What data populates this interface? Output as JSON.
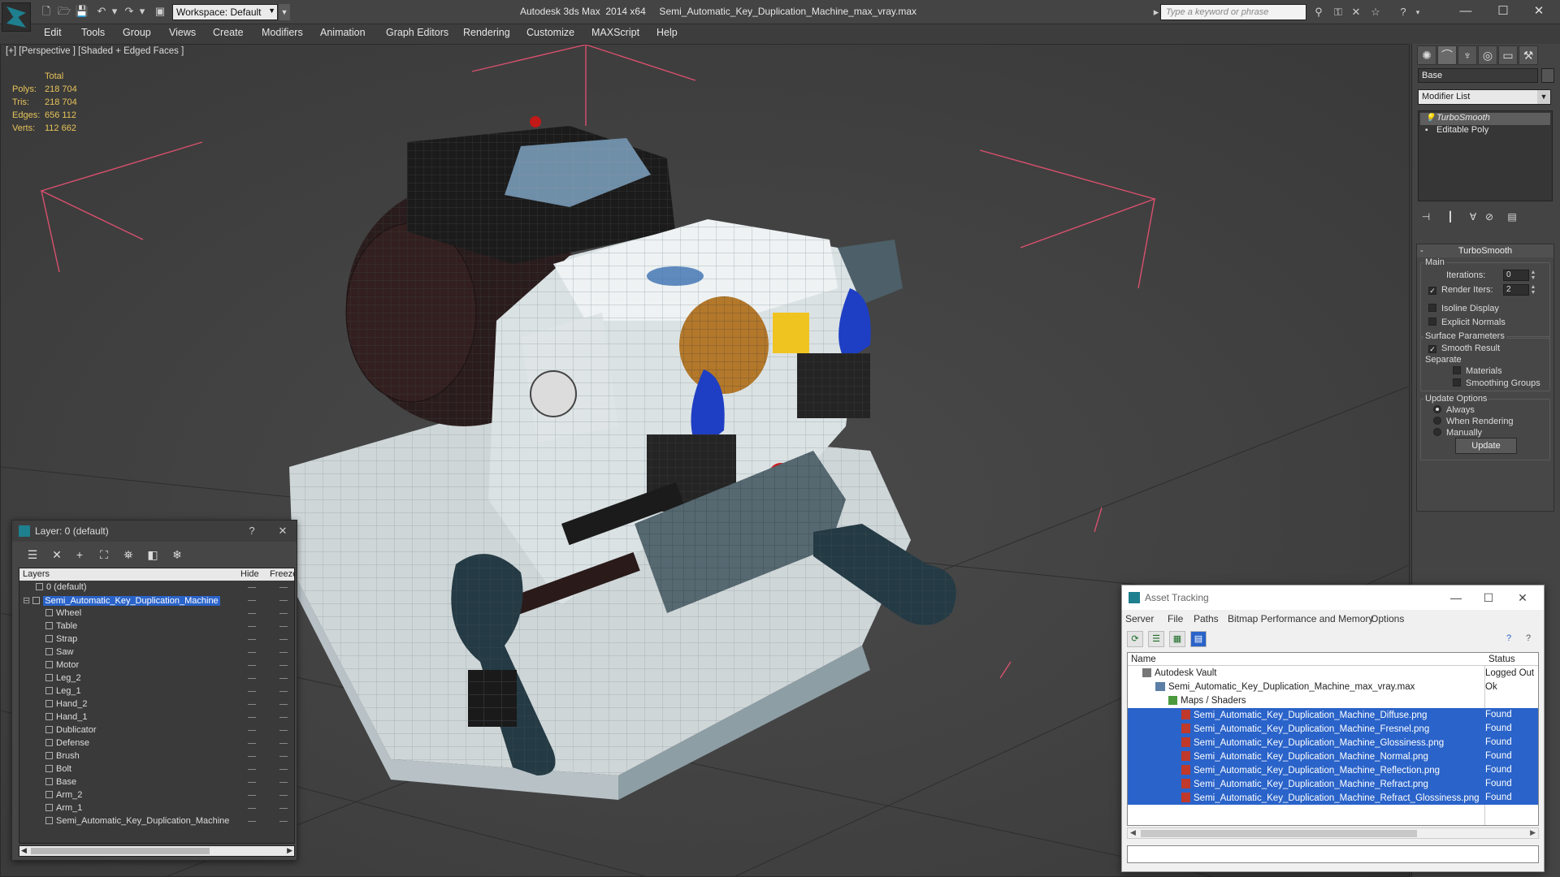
{
  "title_bar": {
    "workspace": "Workspace: Default",
    "app_title": "Autodesk 3ds Max  2014 x64     Semi_Automatic_Key_Duplication_Machine_max_vray.max",
    "search_placeholder": "Type a keyword or phrase"
  },
  "menu": [
    "Edit",
    "Tools",
    "Group",
    "Views",
    "Create",
    "Modifiers",
    "Animation",
    "Graph Editors",
    "Rendering",
    "Customize",
    "MAXScript",
    "Help"
  ],
  "viewport": {
    "label": "[+] [Perspective ] [Shaded + Edged Faces ]",
    "stats": {
      "header": "Total",
      "polys_label": "Polys:",
      "polys": "218 704",
      "tris_label": "Tris:",
      "tris": "218 704",
      "edges_label": "Edges:",
      "edges": "656 112",
      "verts_label": "Verts:",
      "verts": "112 662"
    }
  },
  "command_panel": {
    "object_name": "Base",
    "modifier_list": "Modifier List",
    "stack": [
      "TurboSmooth",
      "Editable Poly"
    ],
    "rollout_title": "TurboSmooth",
    "main_group": "Main",
    "iterations_label": "Iterations:",
    "iterations_value": "0",
    "render_iters_label": "Render Iters:",
    "render_iters_value": "2",
    "isoline": "Isoline Display",
    "explicit_normals": "Explicit Normals",
    "surface_group": "Surface Parameters",
    "smooth_result": "Smooth Result",
    "separate": "Separate",
    "materials": "Materials",
    "smoothing_groups": "Smoothing Groups",
    "update_group": "Update Options",
    "always": "Always",
    "when_rendering": "When Rendering",
    "manually": "Manually",
    "update_button": "Update"
  },
  "layer_dialog": {
    "title": "Layer: 0 (default)",
    "help": "?",
    "col_layers": "Layers",
    "col_hide": "Hide",
    "col_freeze": "Freeze",
    "layers": [
      "0 (default)",
      "Semi_Automatic_Key_Duplication_Machine"
    ],
    "objects": [
      "Wheel",
      "Table",
      "Strap",
      "Saw",
      "Motor",
      "Leg_2",
      "Leg_1",
      "Hand_2",
      "Hand_1",
      "Dublicator",
      "Defense",
      "Brush",
      "Bolt",
      "Base",
      "Arm_2",
      "Arm_1",
      "Semi_Automatic_Key_Duplication_Machine"
    ]
  },
  "asset_tracking": {
    "title": "Asset Tracking",
    "menu": [
      "Server",
      "File",
      "Paths",
      "Bitmap Performance and Memory",
      "Options"
    ],
    "col_name": "Name",
    "col_status": "Status",
    "rows": [
      {
        "name": "Autodesk Vault",
        "status": "Logged Out"
      },
      {
        "name": "Semi_Automatic_Key_Duplication_Machine_max_vray.max",
        "status": "Ok"
      },
      {
        "name": "Maps / Shaders",
        "status": ""
      },
      {
        "name": "Semi_Automatic_Key_Duplication_Machine_Diffuse.png",
        "status": "Found"
      },
      {
        "name": "Semi_Automatic_Key_Duplication_Machine_Fresnel.png",
        "status": "Found"
      },
      {
        "name": "Semi_Automatic_Key_Duplication_Machine_Glossiness.png",
        "status": "Found"
      },
      {
        "name": "Semi_Automatic_Key_Duplication_Machine_Normal.png",
        "status": "Found"
      },
      {
        "name": "Semi_Automatic_Key_Duplication_Machine_Reflection.png",
        "status": "Found"
      },
      {
        "name": "Semi_Automatic_Key_Duplication_Machine_Refract.png",
        "status": "Found"
      },
      {
        "name": "Semi_Automatic_Key_Duplication_Machine_Refract_Glossiness.png",
        "status": "Found"
      }
    ]
  },
  "colors": {
    "accent": "#2a63c9",
    "stats": "#e6c35a",
    "grid_pink": "#d9506e",
    "viewport_bg": "#424242"
  }
}
